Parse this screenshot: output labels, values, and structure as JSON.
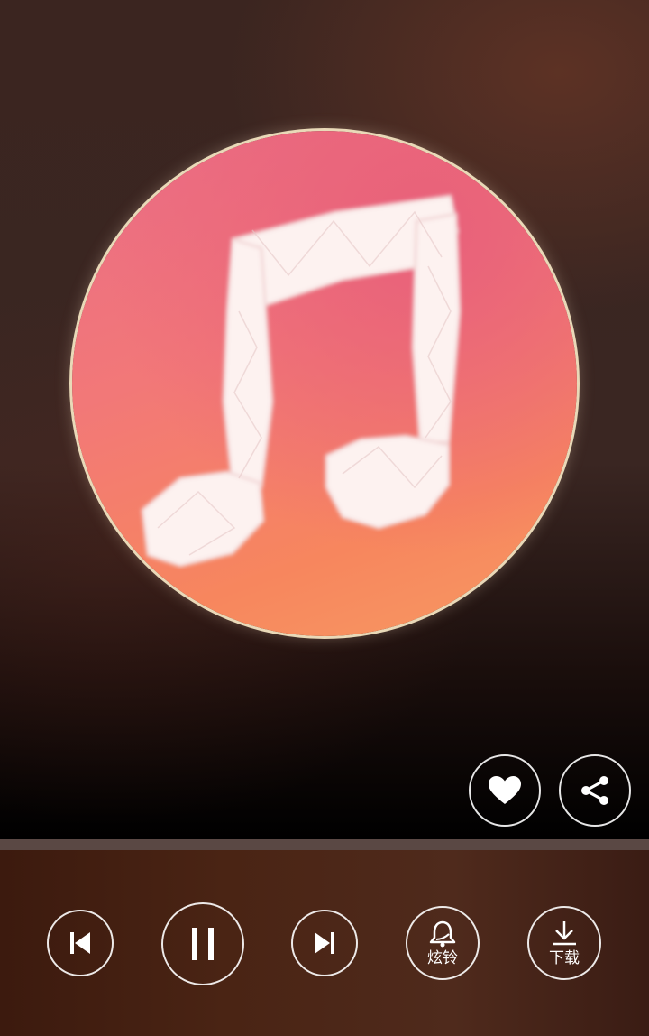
{
  "player": {
    "progress_fraction": 0.0,
    "actions": {
      "favorite": {
        "icon": "heart-icon"
      },
      "share": {
        "icon": "share-icon"
      }
    },
    "controls": {
      "previous": {
        "icon": "skip-previous-icon"
      },
      "pause": {
        "icon": "pause-icon"
      },
      "next": {
        "icon": "skip-next-icon"
      },
      "ringtone": {
        "icon": "bell-icon",
        "label": "炫铃"
      },
      "download": {
        "icon": "download-icon",
        "label": "下载"
      }
    }
  },
  "colors": {
    "album_background": "#f27878",
    "album_border": "#e9d9b8",
    "icon": "#ffffff"
  }
}
